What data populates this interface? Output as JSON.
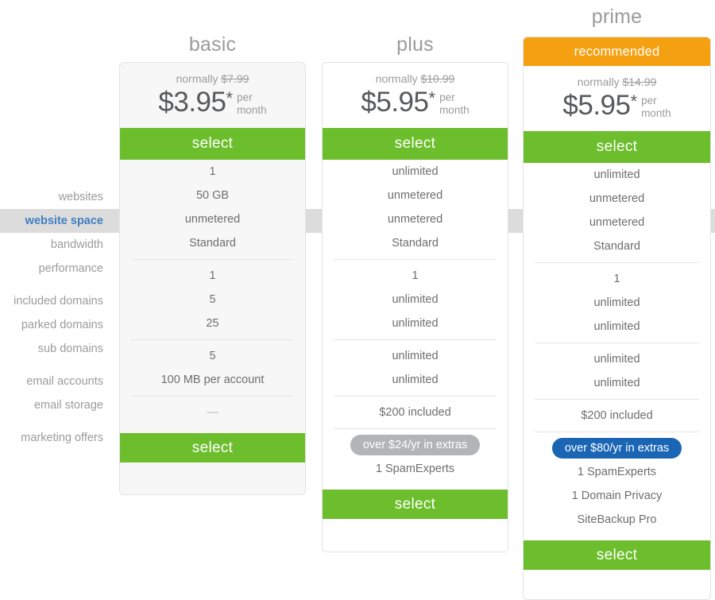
{
  "hover_row": {
    "label": "website space",
    "highlight_color": "#dcdcdc",
    "active_label_color": "#3f7fc1"
  },
  "colors": {
    "select_green": "#6cbe2c",
    "recommended_orange": "#f5a011",
    "pill_gray": "#b3b4b6",
    "pill_blue": "#1a66b5",
    "label_gray": "#9a9b9d",
    "value_gray": "#6d6e71"
  },
  "feature_labels": {
    "websites": "websites",
    "website_space": "website space",
    "bandwidth": "bandwidth",
    "performance": "performance",
    "included_domains": "included domains",
    "parked_domains": "parked domains",
    "sub_domains": "sub domains",
    "email_accounts": "email accounts",
    "email_storage": "email storage",
    "marketing_offers": "marketing offers"
  },
  "plans": {
    "basic": {
      "name": "basic",
      "normally_label": "normally",
      "normally_price": "$7.99",
      "price": "$3.95",
      "star": "*",
      "per": "per",
      "month": "month",
      "select_top": "select",
      "select_bottom": "select",
      "websites": "1",
      "website_space": "50 GB",
      "bandwidth": "unmetered",
      "performance": "Standard",
      "included_domains": "1",
      "parked_domains": "5",
      "sub_domains": "25",
      "email_accounts": "5",
      "email_storage": "100 MB per account",
      "marketing_offers": "—"
    },
    "plus": {
      "name": "plus",
      "normally_label": "normally",
      "normally_price": "$10.99",
      "price": "$5.95",
      "star": "*",
      "per": "per",
      "month": "month",
      "select_top": "select",
      "select_bottom": "select",
      "websites": "unlimited",
      "website_space": "unmetered",
      "bandwidth": "unmetered",
      "performance": "Standard",
      "included_domains": "1",
      "parked_domains": "unlimited",
      "sub_domains": "unlimited",
      "email_accounts": "unlimited",
      "email_storage": "unlimited",
      "marketing_offers": "$200 included",
      "extras_badge": "over $24/yr in extras",
      "extras": [
        "1 SpamExperts"
      ]
    },
    "prime": {
      "name": "prime",
      "recommended": "recommended",
      "normally_label": "normally",
      "normally_price": "$14.99",
      "price": "$5.95",
      "star": "*",
      "per": "per",
      "month": "month",
      "select_top": "select",
      "select_bottom": "select",
      "websites": "unlimited",
      "website_space": "unmetered",
      "bandwidth": "unmetered",
      "performance": "Standard",
      "included_domains": "1",
      "parked_domains": "unlimited",
      "sub_domains": "unlimited",
      "email_accounts": "unlimited",
      "email_storage": "unlimited",
      "marketing_offers": "$200 included",
      "extras_badge": "over $80/yr in extras",
      "extras": [
        "1 SpamExperts",
        "1 Domain Privacy",
        "SiteBackup Pro"
      ]
    }
  }
}
